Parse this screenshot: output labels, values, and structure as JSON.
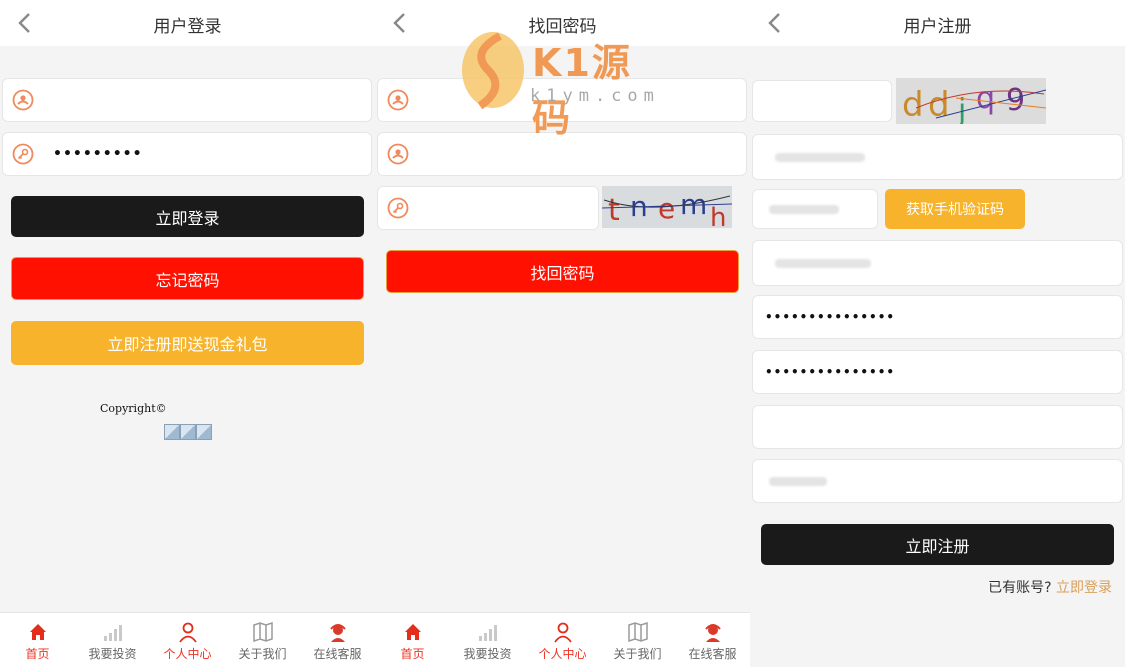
{
  "screens": {
    "login": {
      "title": "用户登录",
      "password_value": "•••••••••",
      "login_button": "立即登录",
      "forgot_button": "忘记密码",
      "register_button": "立即注册即送现金礼包",
      "copyright": "Copyright©"
    },
    "recover": {
      "title": "找回密码",
      "captcha_text": "tnemh",
      "submit_button": "找回密码"
    },
    "register": {
      "title": "用户注册",
      "captcha_text": "ddjq9",
      "sms_button": "获取手机验证码",
      "password_value": "•••••••••••••••",
      "confirm_value": "•••••••••••••••",
      "submit_button": "立即注册",
      "have_account": "已有账号?",
      "login_link": "立即登录"
    }
  },
  "tabbar": [
    {
      "label": "首页",
      "icon": "home-icon",
      "active": true
    },
    {
      "label": "我要投资",
      "icon": "signal-bars-icon",
      "active": false
    },
    {
      "label": "个人中心",
      "icon": "person-icon",
      "active": true
    },
    {
      "label": "关于我们",
      "icon": "map-icon",
      "active": false
    },
    {
      "label": "在线客服",
      "icon": "support-agent-icon",
      "active": false
    }
  ],
  "watermark": {
    "brand": "K1源码",
    "domain": "k1ym.com"
  },
  "colors": {
    "accent_red": "#ff1000",
    "accent_yellow": "#f6b32b",
    "dark_button": "#1a1a1a",
    "icon_orange": "#f08a5d"
  }
}
